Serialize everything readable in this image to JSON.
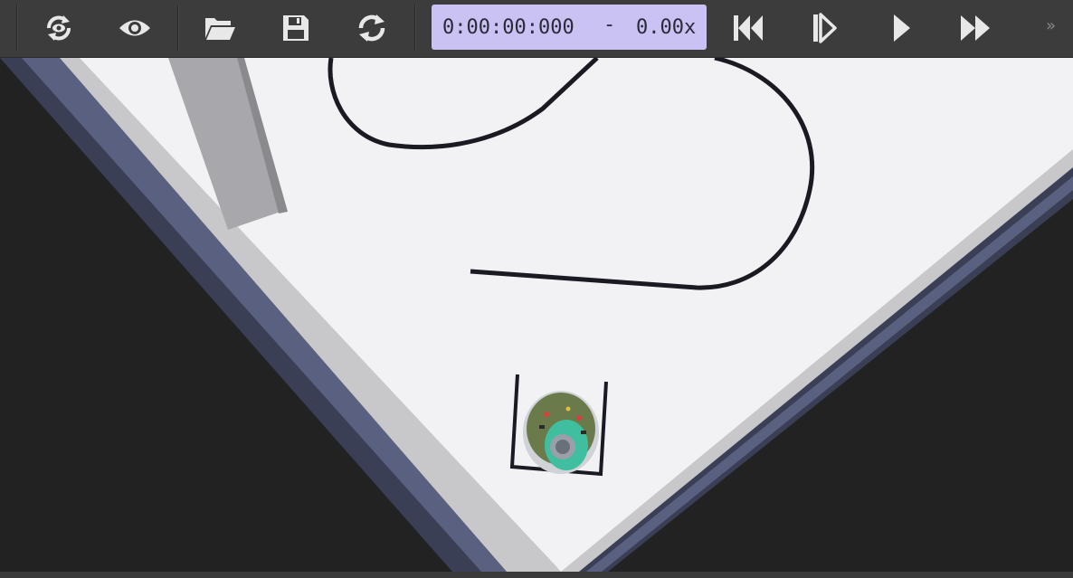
{
  "toolbar": {
    "buttons": [
      {
        "name": "reload-world-button",
        "icon": "reload-world-icon"
      },
      {
        "name": "show-hide-button",
        "icon": "eye-icon"
      },
      {
        "name": "open-world-button",
        "icon": "folder-open-icon"
      },
      {
        "name": "save-world-button",
        "icon": "save-icon"
      },
      {
        "name": "reset-simulation-button",
        "icon": "refresh-icon"
      },
      {
        "name": "step-back-button",
        "icon": "rewind-icon"
      },
      {
        "name": "step-button",
        "icon": "step-icon"
      },
      {
        "name": "run-button",
        "icon": "play-icon"
      },
      {
        "name": "fast-forward-button",
        "icon": "fast-forward-icon"
      }
    ],
    "simulation_time": "0:00:00:000",
    "time_separator": "-",
    "speed": "0.00x",
    "overflow_label": "»",
    "accent_color": "#c9c2f2",
    "background_color": "#3c3c3c"
  },
  "scene": {
    "arena_color": "#f2f2f4",
    "wall_color": "#c8c8ca",
    "floor_color": "#222223",
    "line_color": "#1a1a22",
    "edge_color": "#5a6080"
  }
}
